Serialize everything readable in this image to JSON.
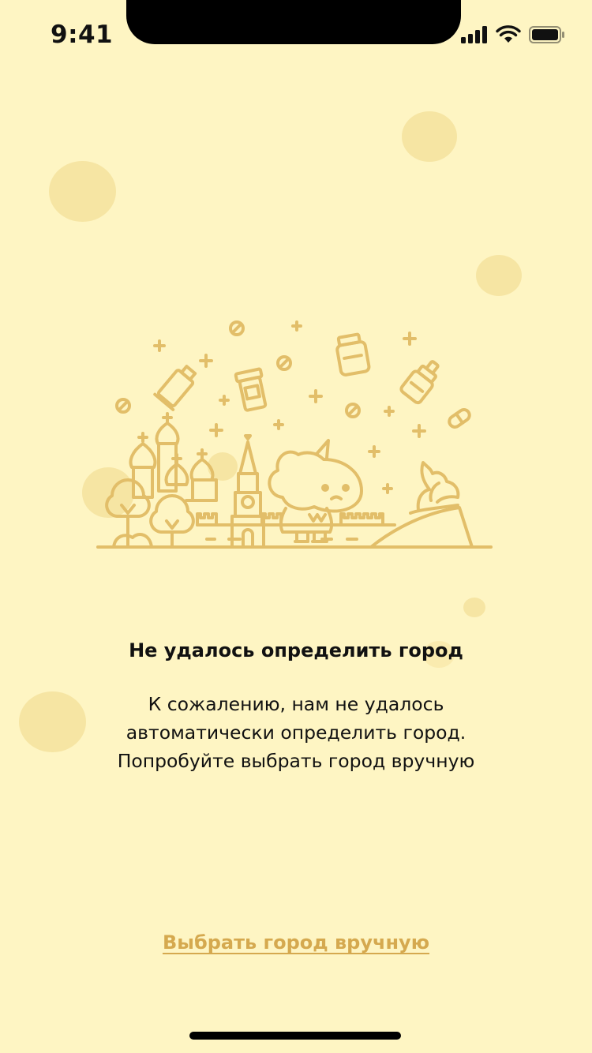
{
  "status_bar": {
    "time": "9:41",
    "icons": [
      "signal-icon",
      "wifi-icon",
      "battery-icon"
    ]
  },
  "colors": {
    "background": "#FEF5C3",
    "blob": "#F6E4A1",
    "illustration_stroke": "#E2BE69",
    "accent_link": "#D5A94F"
  },
  "error": {
    "title": "Не удалось определить город",
    "message_lines": [
      "К сожалению, нам не удалось",
      "автоматически определить город.",
      "Попробуйте выбрать город вручную"
    ]
  },
  "actions": {
    "choose_city_manually": "Выбрать город вручную"
  }
}
